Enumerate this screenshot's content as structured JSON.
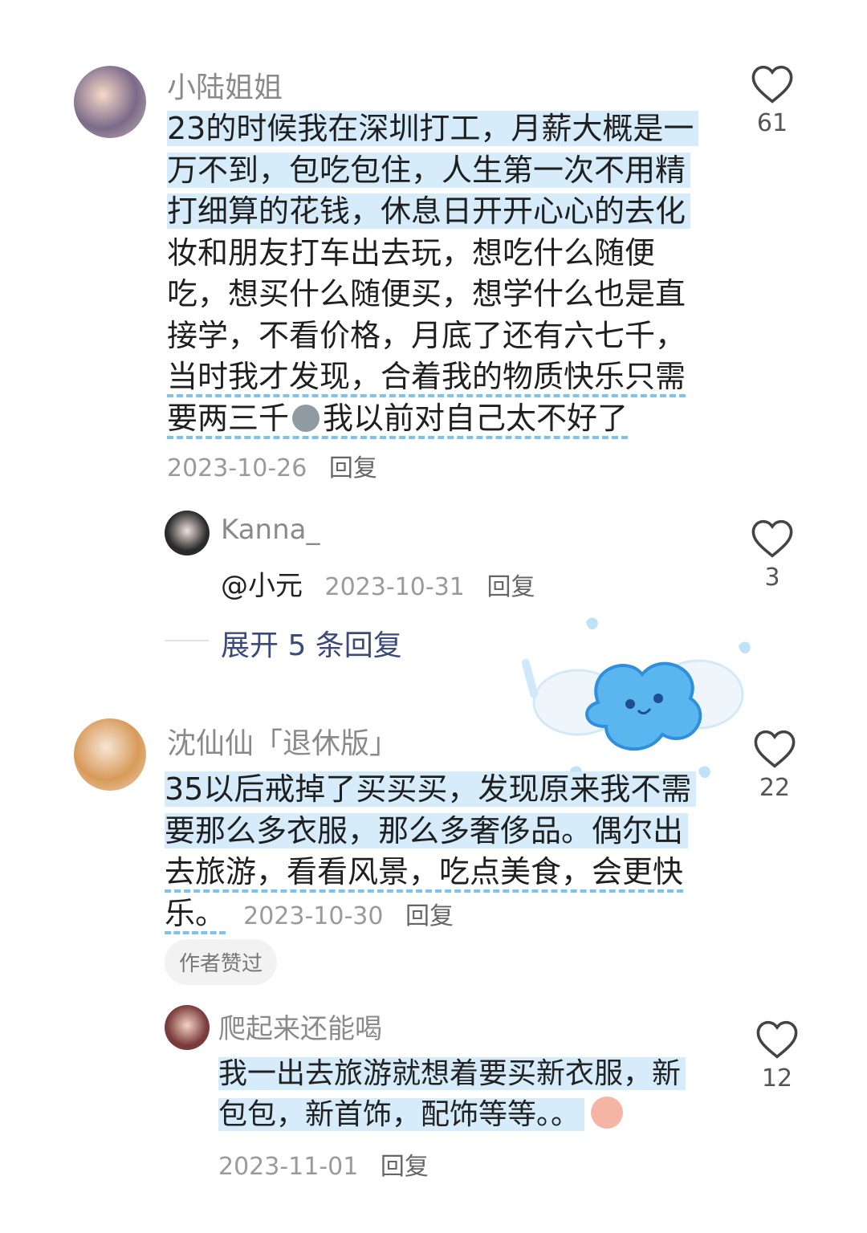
{
  "comments": [
    {
      "username": "小陆姐姐",
      "lines": [
        "23的时候我在深圳打工，月薪大概是一",
        "万不到，包吃包住，人生第一次不用精",
        "打细算的花钱，休息日开开心心的去化",
        "妆和朋友打车出去玩，想吃什么随便",
        "吃，想买什么随便买，想学什么也是直",
        "接学，不看价格，月底了还有六七千，",
        "当时我才发现，合着我的物质快乐只需",
        "要两三千",
        "我以前对自己太不好了"
      ],
      "date": "2023-10-26",
      "reply_label": "回复",
      "likes": "61",
      "sub_reply": {
        "username": "Kanna_",
        "text": "@小元",
        "date": "2023-10-31",
        "reply_label": "回复",
        "likes": "3"
      },
      "expand_label": "展开 5 条回复"
    },
    {
      "username": "沈仙仙「退休版」",
      "lines": [
        "35以后戒掉了买买买，发现原来我不需",
        "要那么多衣服，那么多奢侈品。偶尔出",
        "去旅游，看看风景，吃点美食，会更快",
        "乐。"
      ],
      "date": "2023-10-30",
      "reply_label": "回复",
      "likes": "22",
      "badge": "作者赞过",
      "sub_reply": {
        "username": "爬起来还能喝",
        "lines": [
          "我一出去旅游就想着要买新衣服，新",
          "包包，新首饰，配饰等等。。"
        ],
        "date": "2023-11-01",
        "reply_label": "回复",
        "likes": "12"
      }
    }
  ],
  "colors": {
    "highlight": "#d6ecfa",
    "underline": "#7cc3f0"
  },
  "icons": [
    "heart-outline-icon",
    "emoji-icon",
    "cloud-sticker"
  ]
}
